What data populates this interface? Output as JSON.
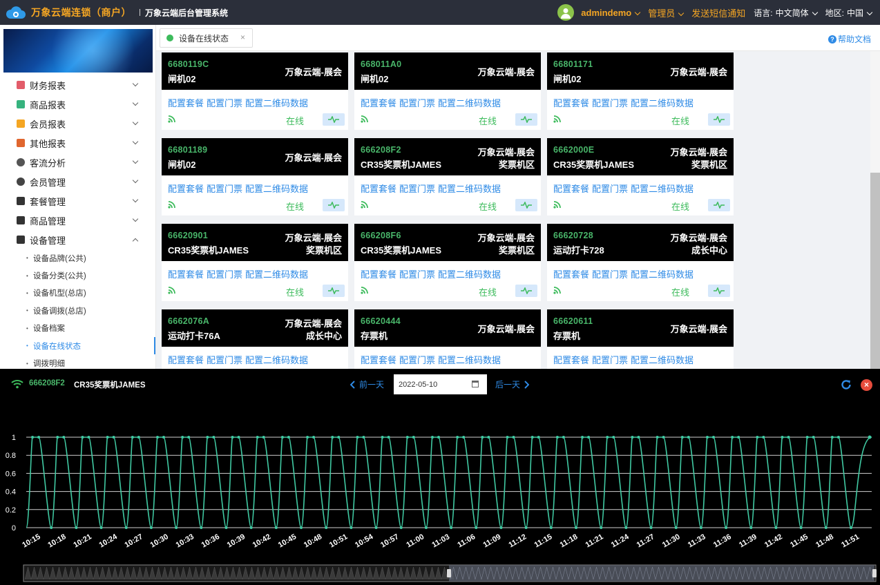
{
  "header": {
    "app_title": "万象云端连锁（商户）",
    "subtitle": "万象云端后台管理系统",
    "username": "admindemo",
    "role": "管理员",
    "sms": "发送短信通知",
    "lang_label": "语言:",
    "lang_value": "中文简体",
    "region_label": "地区:",
    "region_value": "中国"
  },
  "sidebar": {
    "menu": [
      {
        "label": "财务报表",
        "icon": "finance-icon",
        "color": "#e25c6a"
      },
      {
        "label": "商品报表",
        "icon": "goods-report-icon",
        "color": "#36b37e"
      },
      {
        "label": "会员报表",
        "icon": "member-report-icon",
        "color": "#f5a623"
      },
      {
        "label": "其他报表",
        "icon": "layers-icon",
        "color": "#e0662e"
      },
      {
        "label": "客流分析",
        "icon": "target-icon",
        "color": "#555555"
      },
      {
        "label": "会员管理",
        "icon": "user-icon",
        "color": "#444444"
      },
      {
        "label": "套餐管理",
        "icon": "edit-icon",
        "color": "#333333"
      },
      {
        "label": "商品管理",
        "icon": "swap-icon",
        "color": "#333333"
      },
      {
        "label": "设备管理",
        "icon": "device-icon",
        "color": "#333333"
      }
    ],
    "submenu": [
      "设备品牌(公共)",
      "设备分类(公共)",
      "设备机型(总店)",
      "设备调拨(总店)",
      "设备档案",
      "设备在线状态",
      "调拨明细"
    ],
    "active_sub": "设备在线状态"
  },
  "tabs": {
    "current": "设备在线状态",
    "close": "×",
    "help": "帮助文档"
  },
  "card_actions": [
    "配置套餐",
    "配置门票",
    "配置二维码数据"
  ],
  "status_online": "在线",
  "devices": [
    {
      "code": "6680119C",
      "name": "闸机02",
      "location": "万象云端-展会",
      "area": ""
    },
    {
      "code": "668011A0",
      "name": "闸机02",
      "location": "万象云端-展会",
      "area": ""
    },
    {
      "code": "66801171",
      "name": "闸机02",
      "location": "万象云端-展会",
      "area": ""
    },
    {
      "code": "66801189",
      "name": "闸机02",
      "location": "万象云端-展会",
      "area": ""
    },
    {
      "code": "666208F2",
      "name": "CR35奖票机JAMES",
      "location": "万象云端-展会",
      "area": "奖票机区"
    },
    {
      "code": "6662000E",
      "name": "CR35奖票机JAMES",
      "location": "万象云端-展会",
      "area": "奖票机区"
    },
    {
      "code": "66620901",
      "name": "CR35奖票机JAMES",
      "location": "万象云端-展会",
      "area": "奖票机区"
    },
    {
      "code": "666208F6",
      "name": "CR35奖票机JAMES",
      "location": "万象云端-展会",
      "area": "奖票机区"
    },
    {
      "code": "66620728",
      "name": "运动打卡728",
      "location": "万象云端-展会",
      "area": "成长中心"
    },
    {
      "code": "6662076A",
      "name": "运动打卡76A",
      "location": "万象云端-展会",
      "area": "成长中心"
    },
    {
      "code": "66620444",
      "name": "存票机",
      "location": "万象云端-展会",
      "area": ""
    },
    {
      "code": "66620611",
      "name": "存票机",
      "location": "万象云端-展会",
      "area": ""
    }
  ],
  "panel": {
    "device_code": "666208F2",
    "device_name": "CR35奖票机JAMES",
    "prev_day": "前一天",
    "next_day": "后一天",
    "date": "2022-05-10"
  },
  "chart_data": {
    "type": "line",
    "title": "",
    "xlabel": "",
    "ylabel": "",
    "ylim": [
      0,
      1
    ],
    "yticks": [
      "0",
      "0.2",
      "0.4",
      "0.6",
      "0.8",
      "1"
    ],
    "xticks": [
      "10:15",
      "10:18",
      "10:21",
      "10:24",
      "10:27",
      "10:30",
      "10:33",
      "10:36",
      "10:39",
      "10:42",
      "10:45",
      "10:48",
      "10:51",
      "10:54",
      "10:57",
      "11:00",
      "11:03",
      "11:06",
      "11:09",
      "11:12",
      "11:15",
      "11:18",
      "11:21",
      "11:24",
      "11:27",
      "11:30",
      "11:33",
      "11:36",
      "11:39",
      "11:42",
      "11:45",
      "11:48",
      "11:51"
    ],
    "series": [
      {
        "name": "",
        "color": "#40c9a2",
        "pattern": "online status toggling 0/1 roughly every 45 seconds from 10:15 to 11:52, ending at 1"
      }
    ],
    "colors": {
      "line": "#40c9a2",
      "grid": "#e8e8e8",
      "axis_text": "#ffffff"
    }
  }
}
